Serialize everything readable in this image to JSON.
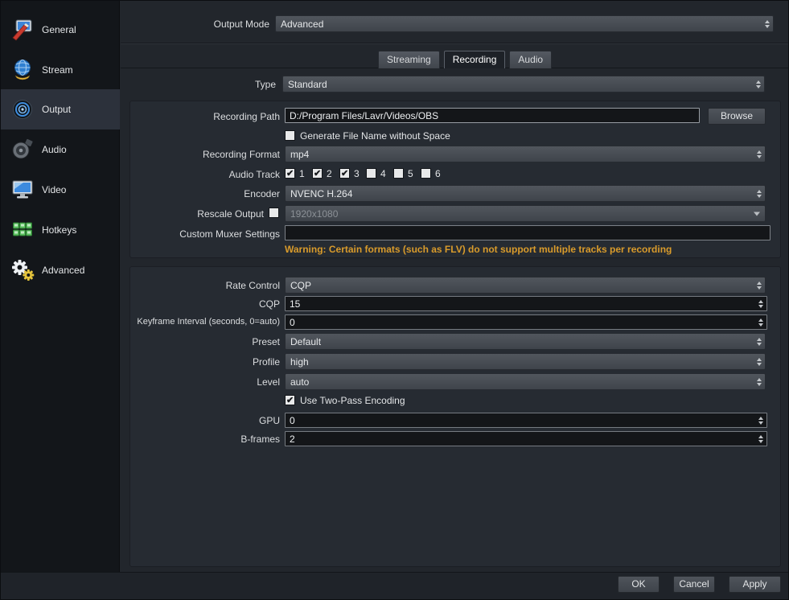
{
  "sidebar": {
    "items": [
      {
        "label": "General"
      },
      {
        "label": "Stream"
      },
      {
        "label": "Output"
      },
      {
        "label": "Audio"
      },
      {
        "label": "Video"
      },
      {
        "label": "Hotkeys"
      },
      {
        "label": "Advanced"
      }
    ]
  },
  "output_mode": {
    "label": "Output Mode",
    "value": "Advanced"
  },
  "tabs": {
    "streaming": "Streaming",
    "recording": "Recording",
    "audio": "Audio"
  },
  "type_row": {
    "label": "Type",
    "value": "Standard"
  },
  "recording": {
    "path": {
      "label": "Recording Path",
      "value": "D:/Program Files/Lavr/Videos/OBS",
      "browse": "Browse"
    },
    "no_space": {
      "label": "Generate File Name without Space",
      "checked": false
    },
    "format": {
      "label": "Recording Format",
      "value": "mp4"
    },
    "audio_track": {
      "label": "Audio Track",
      "tracks": [
        {
          "label": "1",
          "checked": true
        },
        {
          "label": "2",
          "checked": true
        },
        {
          "label": "3",
          "checked": true
        },
        {
          "label": "4",
          "checked": false
        },
        {
          "label": "5",
          "checked": false
        },
        {
          "label": "6",
          "checked": false
        }
      ]
    },
    "encoder": {
      "label": "Encoder",
      "value": "NVENC H.264"
    },
    "rescale": {
      "label": "Rescale Output",
      "checked": false,
      "value": "1920x1080",
      "disabled": true
    },
    "muxer": {
      "label": "Custom Muxer Settings",
      "value": ""
    },
    "warning": "Warning: Certain formats (such as FLV) do not support multiple tracks per recording"
  },
  "encoder_settings": {
    "rate_control": {
      "label": "Rate Control",
      "value": "CQP"
    },
    "cqp": {
      "label": "CQP",
      "value": "15"
    },
    "keyframe": {
      "label": "Keyframe Interval (seconds, 0=auto)",
      "value": "0"
    },
    "preset": {
      "label": "Preset",
      "value": "Default"
    },
    "profile": {
      "label": "Profile",
      "value": "high"
    },
    "level": {
      "label": "Level",
      "value": "auto"
    },
    "two_pass": {
      "label": "Use Two-Pass Encoding",
      "checked": true
    },
    "gpu": {
      "label": "GPU",
      "value": "0"
    },
    "bframes": {
      "label": "B-frames",
      "value": "2"
    }
  },
  "footer": {
    "ok": "OK",
    "cancel": "Cancel",
    "apply": "Apply"
  },
  "colors": {
    "warning_text": "#d99b2b",
    "sidebar_selected": "#2c313b",
    "pane_bg": "#22262c"
  }
}
